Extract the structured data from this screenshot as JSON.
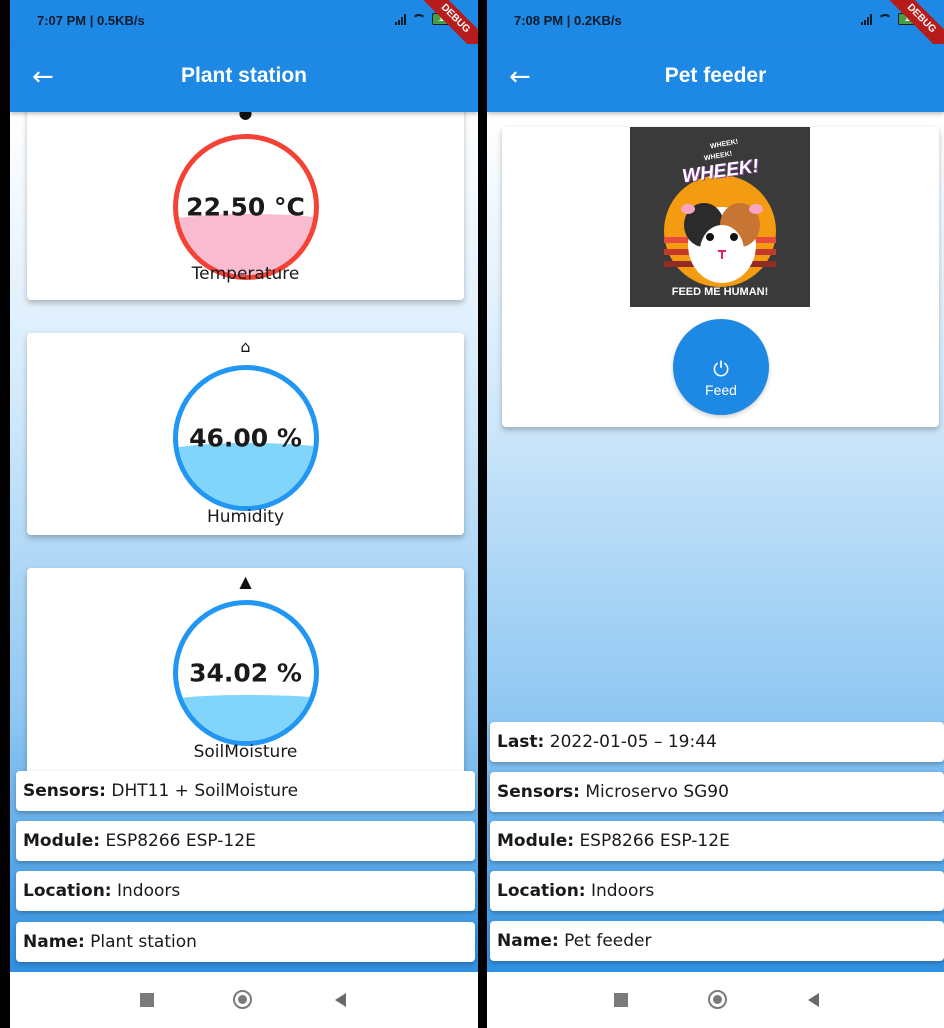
{
  "left": {
    "status": {
      "time": "7:07 PM | 0.5KB/s",
      "battery": "13",
      "debug": "DEBUG"
    },
    "appbar": {
      "back": "←",
      "title": "Plant station"
    },
    "sensors": [
      {
        "icon": "thermometer-icon",
        "glyph": "●",
        "value": "22.50 °C",
        "label": "Temperature",
        "fill_fraction": 0.45,
        "color": "#f44336",
        "fill_color": "#f8bbd0"
      },
      {
        "icon": "home-icon",
        "glyph": "⌂",
        "value": "46.00 %",
        "label": "Humidity",
        "fill_fraction": 0.46,
        "color": "#2196f3",
        "fill_color": "#81d4fa"
      },
      {
        "icon": "terrain-icon",
        "glyph": "▲",
        "value": "34.02 %",
        "label": "SoilMoisture",
        "fill_fraction": 0.34,
        "color": "#2196f3",
        "fill_color": "#81d4fa"
      }
    ],
    "info": [
      {
        "key": "Sensors:",
        "value": "DHT11 + SoilMoisture"
      },
      {
        "key": "Module:",
        "value": "ESP8266 ESP-12E"
      },
      {
        "key": "Location:",
        "value": "Indoors"
      },
      {
        "key": "Name:",
        "value": "Plant station"
      }
    ]
  },
  "right": {
    "status": {
      "time": "7:08 PM | 0.2KB/s",
      "battery": "13",
      "debug": "DEBUG"
    },
    "appbar": {
      "back": "←",
      "title": "Pet feeder"
    },
    "poster": {
      "wheek_small_1": "WHEEK!",
      "wheek_small_2": "WHEEK!",
      "wheek_big": "WHEEK!",
      "caption": "FEED ME HUMAN!"
    },
    "feed_button": {
      "icon": "power-icon",
      "glyph": "⏻",
      "label": "Feed"
    },
    "info": [
      {
        "key": "Last:",
        "value": "2022-01-05 – 19:44"
      },
      {
        "key": "Sensors:",
        "value": "Microservo SG90"
      },
      {
        "key": "Module:",
        "value": "ESP8266 ESP-12E"
      },
      {
        "key": "Location:",
        "value": "Indoors"
      },
      {
        "key": "Name:",
        "value": "Pet feeder"
      }
    ]
  },
  "colors": {
    "appbar": "#1e88e5",
    "accent": "#2196f3",
    "danger": "#f44336"
  }
}
